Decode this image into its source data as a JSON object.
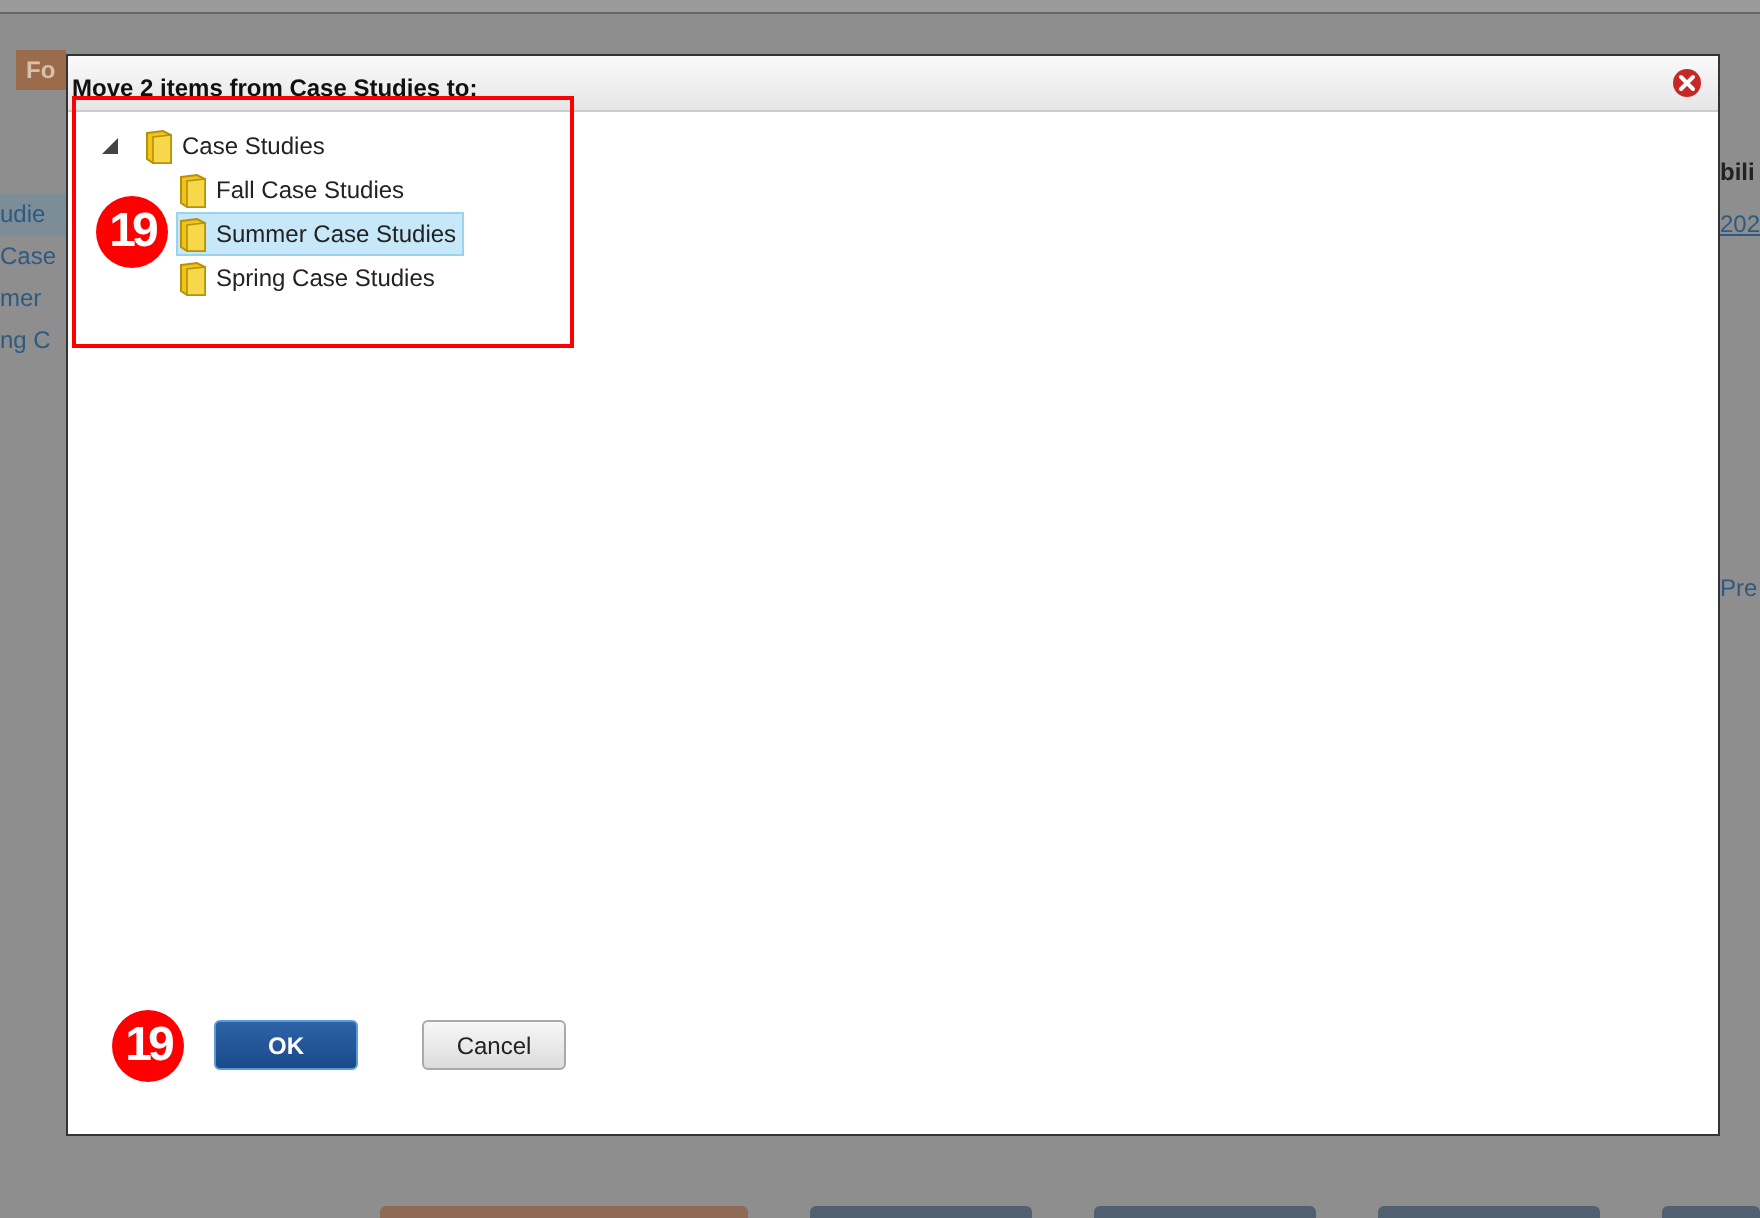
{
  "background": {
    "tab": "Fo",
    "left_items": [
      {
        "label": "udie",
        "selected": true
      },
      {
        "label": "Case",
        "selected": false
      },
      {
        "label": "mer",
        "selected": false
      },
      {
        "label": "ng C",
        "selected": false
      }
    ],
    "right_texts": [
      {
        "text": "bili",
        "kind": "header"
      },
      {
        "text": "202",
        "kind": "link"
      },
      {
        "text": "Pre",
        "kind": "link"
      }
    ]
  },
  "dialog": {
    "title": "Move 2 items from Case Studies to:",
    "tree": [
      {
        "label": "Case Studies",
        "expanded": true,
        "selected": false,
        "children": [
          {
            "label": "Fall Case Studies",
            "selected": false
          },
          {
            "label": "Summer Case Studies",
            "selected": true
          },
          {
            "label": "Spring Case Studies",
            "selected": false
          }
        ]
      }
    ],
    "buttons": [
      {
        "label": "OK",
        "kind": "primary"
      },
      {
        "label": "Cancel",
        "kind": "secondary"
      }
    ]
  },
  "annotations": [
    {
      "text": "19"
    },
    {
      "text": "19"
    }
  ]
}
